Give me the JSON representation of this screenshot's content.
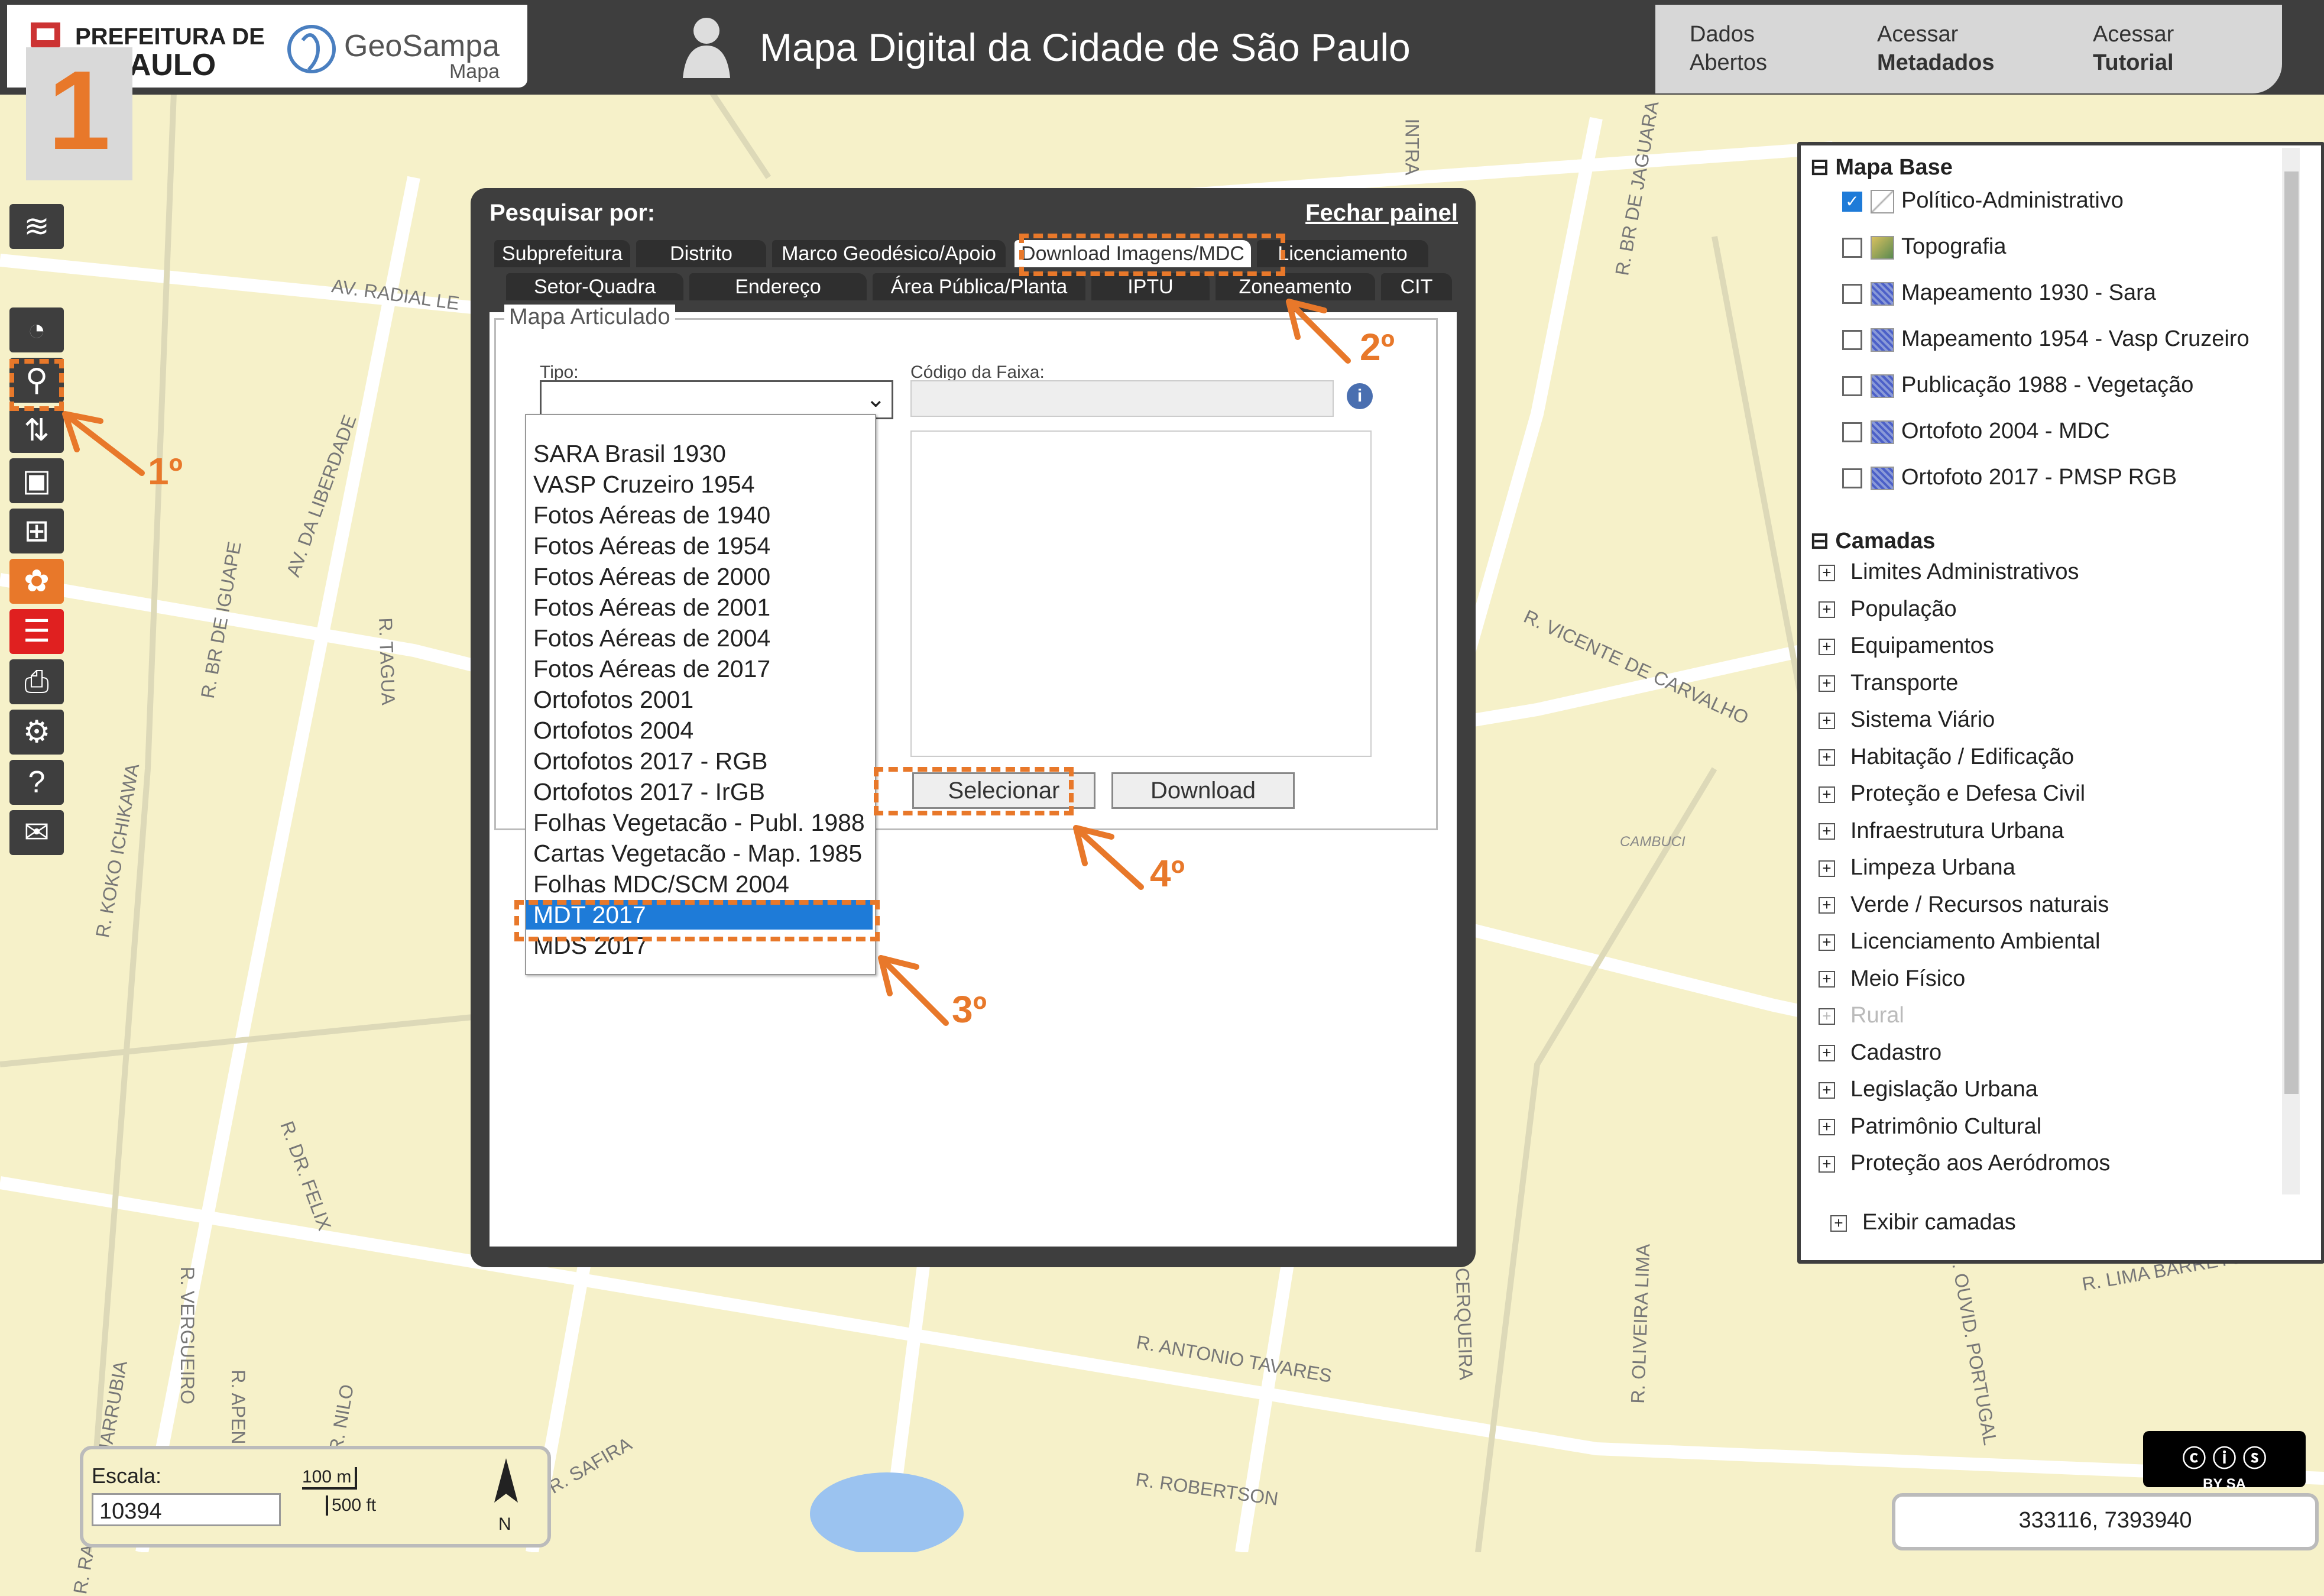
{
  "header": {
    "pref_line1": "PREFEITURA DE",
    "pref_line2": "PAULO",
    "geosampa": "GeoSampa",
    "geosampa_sub": "Mapa",
    "title": "Mapa Digital da Cidade de São Paulo",
    "nav": [
      {
        "line1": "Dados",
        "line2": "Abertos"
      },
      {
        "line1": "Acessar",
        "line2": "Metadados"
      },
      {
        "line1": "Acessar",
        "line2": "Tutorial"
      }
    ]
  },
  "step_number": "1",
  "annotations": [
    "1º",
    "2º",
    "3º",
    "4º"
  ],
  "dialog": {
    "search_label": "Pesquisar por:",
    "close_label": "Fechar painel",
    "tabs_row1": [
      "Subprefeitura",
      "Distrito",
      "Marco Geodésico/Apoio",
      "Download Imagens/MDC",
      "Licenciamento"
    ],
    "tabs_row2": [
      "Setor-Quadra",
      "Endereço",
      "Área Pública/Planta",
      "IPTU",
      "Zoneamento",
      "CIT"
    ],
    "fieldset_legend": "Mapa Articulado",
    "tipo_label": "Tipo:",
    "codigo_label": "Código da Faixa:",
    "options": [
      "SARA Brasil 1930",
      "VASP Cruzeiro 1954",
      "Fotos Aéreas de 1940",
      "Fotos Aéreas de 1954",
      "Fotos Aéreas de 2000",
      "Fotos Aéreas de 2001",
      "Fotos Aéreas de 2004",
      "Fotos Aéreas de 2017",
      "Ortofotos 2001",
      "Ortofotos 2004",
      "Ortofotos 2017 - RGB",
      "Ortofotos 2017 - IrGB",
      "Folhas Vegetacão - Publ. 1988",
      "Cartas Vegetacão - Map. 1985",
      "Folhas MDC/SCM 2004",
      "MDT 2017",
      "MDS 2017"
    ],
    "selected_option": "MDT 2017",
    "btn_select": "Selecionar",
    "btn_download": "Download"
  },
  "layers": {
    "mapa_base_title": "Mapa Base",
    "mapa_base": [
      {
        "label": "Político-Administrativo",
        "checked": true
      },
      {
        "label": "Topografia",
        "checked": false
      },
      {
        "label": "Mapeamento 1930 - Sara",
        "checked": false
      },
      {
        "label": "Mapeamento 1954 - Vasp Cruzeiro",
        "checked": false
      },
      {
        "label": "Publicação 1988 - Vegetação",
        "checked": false
      },
      {
        "label": "Ortofoto 2004 - MDC",
        "checked": false
      },
      {
        "label": "Ortofoto 2017 - PMSP RGB",
        "checked": false
      }
    ],
    "camadas_title": "Camadas",
    "camadas": [
      "Limites Administrativos",
      "População",
      "Equipamentos",
      "Transporte",
      "Sistema Viário",
      "Habitação / Edificação",
      "Proteção e Defesa Civil",
      "Infraestrutura Urbana",
      "Limpeza Urbana",
      "Verde / Recursos naturais",
      "Licenciamento Ambiental",
      "Meio Físico",
      "Rural",
      "Cadastro",
      "Legislação Urbana",
      "Patrimônio Cultural",
      "Proteção aos Aeródromos"
    ],
    "exibir": "Exibir camadas"
  },
  "streets": [
    "AV. RADIAL LE",
    "AV. DA LIBERDADE",
    "R. BR DE IGUAPE",
    "R. TAGUA",
    "R. KOKO ICHIKAWA",
    "R. DR. FELIX",
    "R. VERGUEIRO",
    "R. NILO",
    "R. APENINOS",
    "R. SAFIRA",
    "R. ROBERTSON",
    "R. ANTONIO TAVARES",
    "R. CERQUEIRA",
    "R. OLIVEIRA LIMA",
    "R. VICENTE DE CARVALHO",
    "R. BR DE JAGUARA",
    "R. LIMA BARRETO",
    "R. OUVID. PORTUGAL",
    "R. RAMON PENHARRUBIA",
    "CAMBUCI",
    "INTRA"
  ],
  "scale": {
    "label": "Escala:",
    "value": "10394",
    "bar_m": "100 m",
    "bar_ft": "500 ft",
    "north": "N"
  },
  "coords": "333116, 7393940",
  "license": "BY  SA"
}
